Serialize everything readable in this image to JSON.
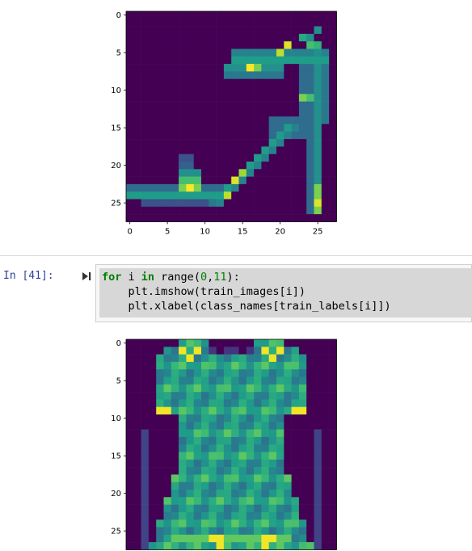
{
  "plots": [
    {
      "image_label": "train image 0 — ankle boot/sandal (heel) 28x28 grayscale rendered with viridis",
      "x_ticks": [
        "0",
        "5",
        "10",
        "15",
        "20",
        "25"
      ],
      "y_ticks": [
        "0",
        "5",
        "10",
        "15",
        "20",
        "25"
      ]
    },
    {
      "image_label": "train image 1 — dress 28x28 rendered with viridis",
      "x_ticks": [],
      "y_ticks": [
        "0",
        "5",
        "10",
        "15",
        "20",
        "25"
      ]
    }
  ],
  "cell": {
    "prompt": "In [41]:",
    "code_lines": [
      {
        "kw": "for",
        "rest_a": " i ",
        "kw2": "in",
        "rest_b": " range(",
        "num1": "0",
        "sep": ",",
        "num2": "11",
        "end": "):"
      },
      {
        "text": "    plt.imshow(train_images[i])"
      },
      {
        "text": "    plt.xlabel(class_names[train_labels[i]])"
      }
    ]
  },
  "colors": {
    "viridis_bg": "#440154",
    "prompt": "#303f9f",
    "keyword": "#008000"
  }
}
